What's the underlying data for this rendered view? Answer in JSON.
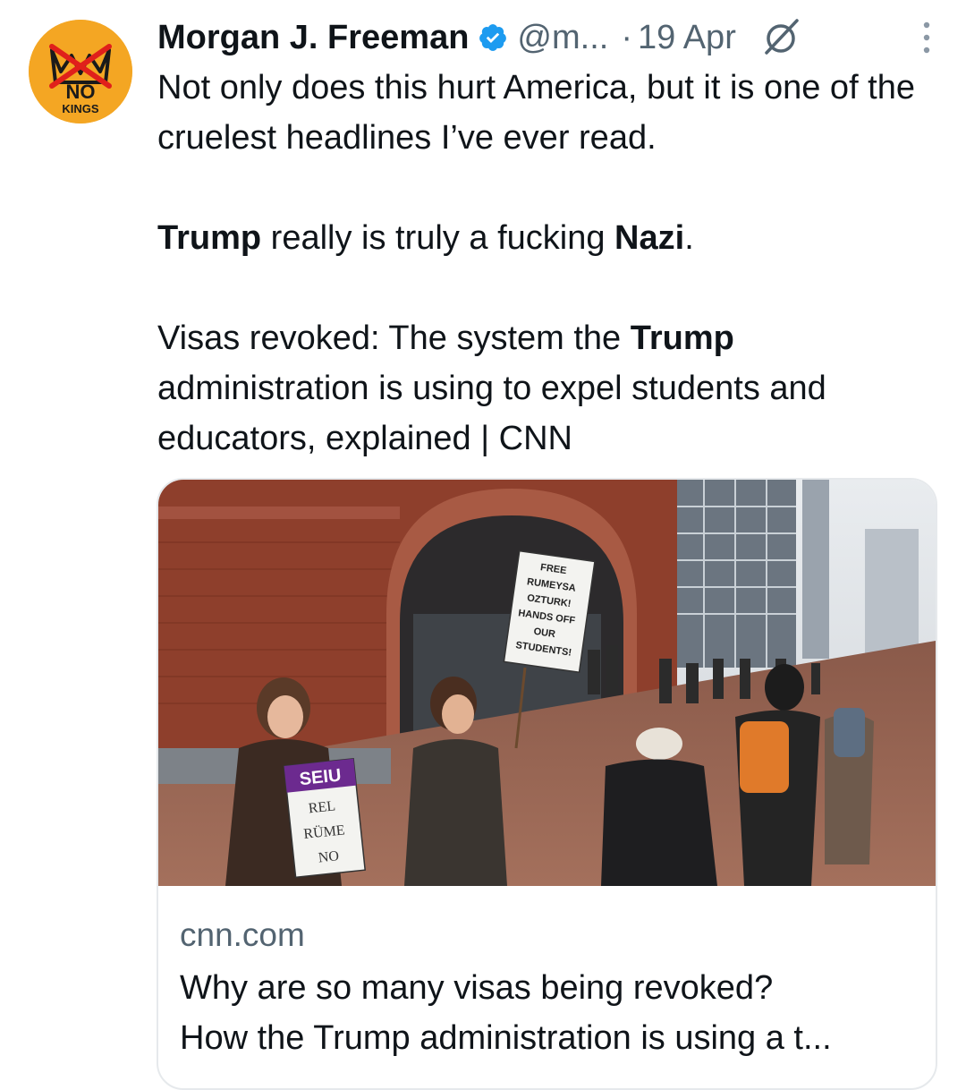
{
  "author": {
    "name": "Morgan J. Freeman",
    "handle": "@m...",
    "separator": "·",
    "date": "19 Apr",
    "avatar_text_top": "NO",
    "avatar_text_bottom": "KINGS"
  },
  "tweet": {
    "line1": "Not only does this hurt America, but it is one of the cruelest headlines I’ve ever read.",
    "p2_bold1": "Trump",
    "p2_mid": " really is truly a fucking ",
    "p2_bold2": "Nazi",
    "p2_end": ".",
    "p3_start": "Visas revoked: The system the ",
    "p3_bold": "Trump",
    "p3_end": " administration is using to expel students and educators, explained | CNN"
  },
  "card": {
    "domain": "cnn.com",
    "title_line1": "Why are so many visas being revoked?",
    "title_line2": "How the Trump administration is using a t...",
    "sign_main": [
      "FREE",
      "RUMEYSA",
      "OZTURK!",
      "HANDS OFF",
      "OUR",
      "STUDENTS!"
    ],
    "sign_left_top": "SEIU",
    "sign_left_lines": [
      "REL",
      "RÜME",
      "NO"
    ]
  },
  "icons": {
    "verified": "verified-badge-icon",
    "grok": "grok-icon",
    "more": "more-options-icon"
  },
  "colors": {
    "verified": "#1d9bf0",
    "secondary_text": "#536471",
    "avatar_bg": "#f4a623"
  }
}
